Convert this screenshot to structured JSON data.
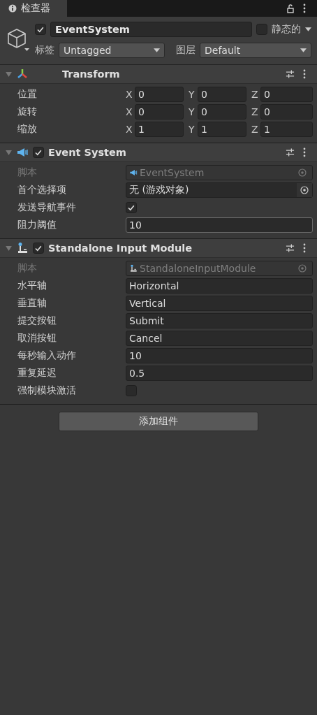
{
  "tab": {
    "title": "检查器"
  },
  "object": {
    "active": true,
    "name": "EventSystem",
    "static": false,
    "static_label": "静态的",
    "tag_label": "标签",
    "tag": "Untagged",
    "layer_label": "图层",
    "layer": "Default"
  },
  "components": [
    {
      "kind": "transform",
      "title": "Transform",
      "expanded": true,
      "rows": [
        {
          "kind": "vector",
          "label": "位置",
          "axes": [
            {
              "axis": "X",
              "value": "0"
            },
            {
              "axis": "Y",
              "value": "0"
            },
            {
              "axis": "Z",
              "value": "0"
            }
          ]
        },
        {
          "kind": "vector",
          "label": "旋转",
          "axes": [
            {
              "axis": "X",
              "value": "0"
            },
            {
              "axis": "Y",
              "value": "0"
            },
            {
              "axis": "Z",
              "value": "0"
            }
          ]
        },
        {
          "kind": "vector",
          "label": "缩放",
          "axes": [
            {
              "axis": "X",
              "value": "1"
            },
            {
              "axis": "Y",
              "value": "1"
            },
            {
              "axis": "Z",
              "value": "1"
            }
          ]
        }
      ]
    },
    {
      "kind": "event_system",
      "title": "Event System",
      "enabled": true,
      "expanded": true,
      "rows": [
        {
          "kind": "script",
          "label": "脚本",
          "value": "EventSystem",
          "disabled": true
        },
        {
          "kind": "object",
          "label": "首个选择项",
          "value": "无 (游戏对象)"
        },
        {
          "kind": "toggle",
          "label": "发送导航事件",
          "checked": true
        },
        {
          "kind": "text",
          "label": "阻力阈值",
          "value": "10",
          "hovered": true
        }
      ]
    },
    {
      "kind": "input_module",
      "title": "Standalone Input Module",
      "enabled": true,
      "expanded": true,
      "rows": [
        {
          "kind": "script",
          "label": "脚本",
          "value": "StandaloneInputModule",
          "disabled": true
        },
        {
          "kind": "text",
          "label": "水平轴",
          "value": "Horizontal",
          "hovered": false
        },
        {
          "kind": "text",
          "label": "垂直轴",
          "value": "Vertical",
          "hovered": false
        },
        {
          "kind": "text",
          "label": "提交按钮",
          "value": "Submit",
          "hovered": false
        },
        {
          "kind": "text",
          "label": "取消按钮",
          "value": "Cancel",
          "hovered": false
        },
        {
          "kind": "text",
          "label": "每秒输入动作",
          "value": "10",
          "hovered": false
        },
        {
          "kind": "text",
          "label": "重复延迟",
          "value": "0.5",
          "hovered": false
        },
        {
          "kind": "toggle",
          "label": "强制模块激活",
          "checked": false
        }
      ]
    }
  ],
  "add_button": "添加组件"
}
